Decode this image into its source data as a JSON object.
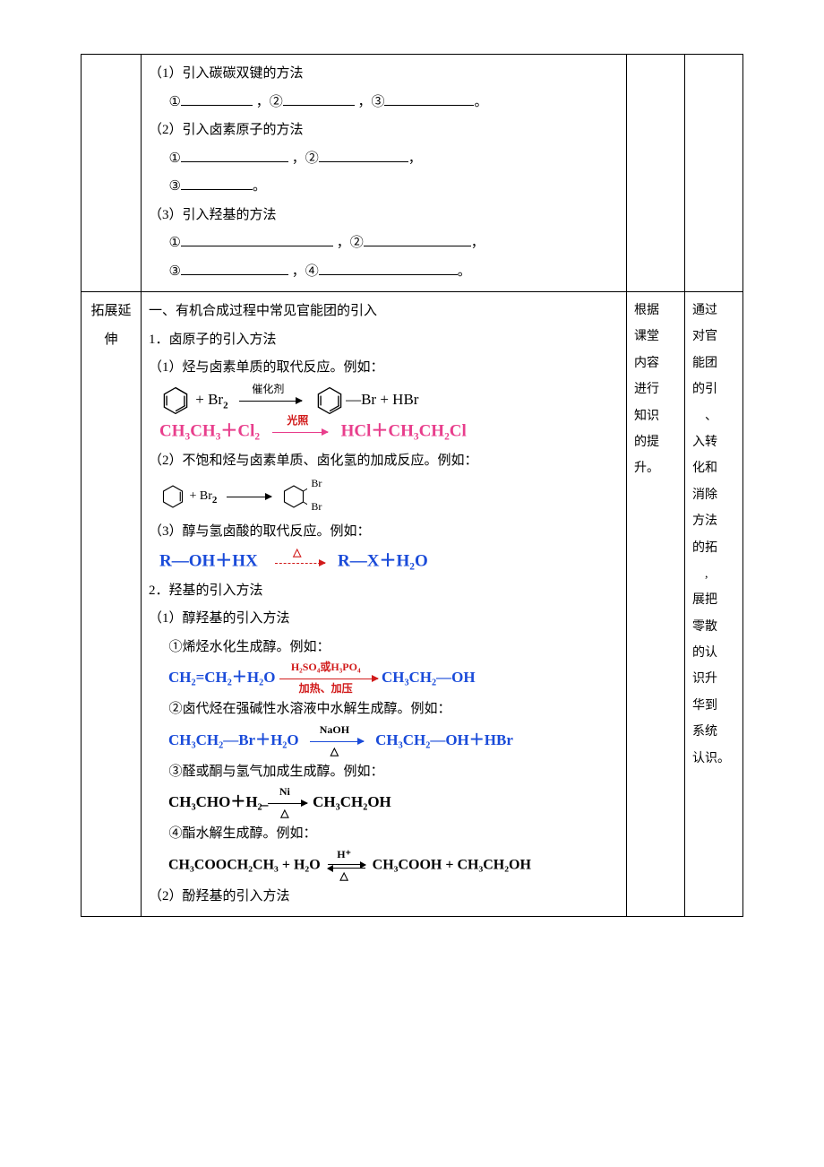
{
  "row1": {
    "q1": "（1）引入碳碳双键的方法",
    "q1_end": "。",
    "q2": "（2）引入卤素原子的方法",
    "q2_end": "。",
    "q3": "（3）引入羟基的方法",
    "q3_end": "。",
    "c1": "①",
    "c2": "，②",
    "c3": "，③",
    "c_comma": "，",
    "c4": "，④"
  },
  "row2": {
    "head": "拓展延伸",
    "h1": "一、有机合成过程中常见官能团的引入",
    "s1": "1．卤原子的引入方法",
    "p11": "（1）烃与卤素单质的取代反应。例如：",
    "eq1": {
      "cond": "催化剂",
      "left_plus": " + Br",
      "left_sub": "2",
      "right": "Br + HBr"
    },
    "eq2": {
      "lhs": "CH₃CH₃＋Cl₂",
      "cond": "光照",
      "rhs": "HCl＋CH₃CH₂Cl"
    },
    "p12": "（2）不饱和烃与卤素单质、卤化氢的加成反应。例如：",
    "eq3": {
      "plus": " + Br",
      "sub": "2",
      "br": "Br"
    },
    "p13": "（3）醇与氢卤酸的取代反应。例如：",
    "eq4": {
      "lhs": "R—OH＋HX",
      "rhs": "R—X＋H₂O",
      "tri": "△"
    },
    "s2": "2．羟基的引入方法",
    "p21": "（1）醇羟基的引入方法",
    "p21a": "①烯烃水化生成醇。例如：",
    "eq5": {
      "lhs": "CH₂=CH₂＋H₂O",
      "top": "H₂SO₄或H₃PO₄",
      "bot": "加热、加压",
      "rhs": "CH₃CH₂—OH"
    },
    "p21b": "②卤代烃在强碱性水溶液中水解生成醇。例如：",
    "eq6": {
      "lhs": "CH₃CH₂—Br＋H₂O",
      "top": "NaOH",
      "bot": "△",
      "rhs": "CH₃CH₂—OH＋HBr"
    },
    "p21c": "③醛或酮与氢气加成生成醇。例如：",
    "eq7": {
      "lhs": "CH₃CHO＋H₂",
      "top": "Ni",
      "bot": "△",
      "rhs": "CH₃CH₂OH"
    },
    "p21d": "④酯水解生成醇。例如：",
    "eq8": {
      "lhs": "CH₃COOCH₂CH₃ + H₂O",
      "top": "H⁺",
      "bot": "△",
      "rhs": "CH₃COOH + CH₃CH₂OH"
    },
    "p22": "（2）酚羟基的引入方法"
  },
  "col3": "根据课堂内容进行知识的提升。",
  "col4": "通过对官能团的引入、转化和消除方法的拓展,把零散的认识升华到系统认识。"
}
